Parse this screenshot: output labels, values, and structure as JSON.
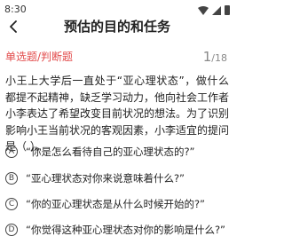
{
  "status_bar": {
    "time": "8:30"
  },
  "header": {
    "title": "预估的目的和任务"
  },
  "question": {
    "type_label": "单选题/判断题",
    "current": "1",
    "total": "/18",
    "text": "小王上大学后一直处于“亚心理状态”，做什么都提不起精神，缺乏学习动力，他向社会工作者小李表达了希望改变目前状况的想法。为了识别影响小王当前状况的客观因素，小李适宜的提问是（ ）。"
  },
  "options": [
    {
      "letter": "A",
      "text": "“你是怎么看待自己的亚心理状态的?”"
    },
    {
      "letter": "B",
      "text": "“亚心理状态对你来说意味着什么?”"
    },
    {
      "letter": "C",
      "text": "“你的亚心理状态是从什么时候开始的?”"
    },
    {
      "letter": "D",
      "text": "“你觉得这种亚心理状态对你的影响是什么?”"
    }
  ]
}
